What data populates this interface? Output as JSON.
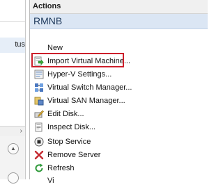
{
  "left_pane": {
    "row_label": "tus"
  },
  "actions": {
    "title": "Actions",
    "group": "RMNB",
    "items": [
      {
        "label": "New",
        "icon": "none"
      },
      {
        "label": "Import Virtual Machine...",
        "icon": "import-vm-icon"
      },
      {
        "label": "Hyper-V Settings...",
        "icon": "hyperv-settings-icon"
      },
      {
        "label": "Virtual Switch Manager...",
        "icon": "virtual-switch-icon"
      },
      {
        "label": "Virtual SAN Manager...",
        "icon": "virtual-san-icon"
      },
      {
        "label": "Edit Disk...",
        "icon": "edit-disk-icon"
      },
      {
        "label": "Inspect Disk...",
        "icon": "inspect-disk-icon"
      },
      {
        "label": "Stop Service",
        "icon": "stop-icon"
      },
      {
        "label": "Remove Server",
        "icon": "remove-x-icon"
      },
      {
        "label": "Refresh",
        "icon": "refresh-icon"
      },
      {
        "label": "Vi",
        "icon": "none"
      }
    ]
  },
  "colors": {
    "group_header_bg": "#dbe6f4",
    "highlight_border": "#cc1f2a"
  }
}
